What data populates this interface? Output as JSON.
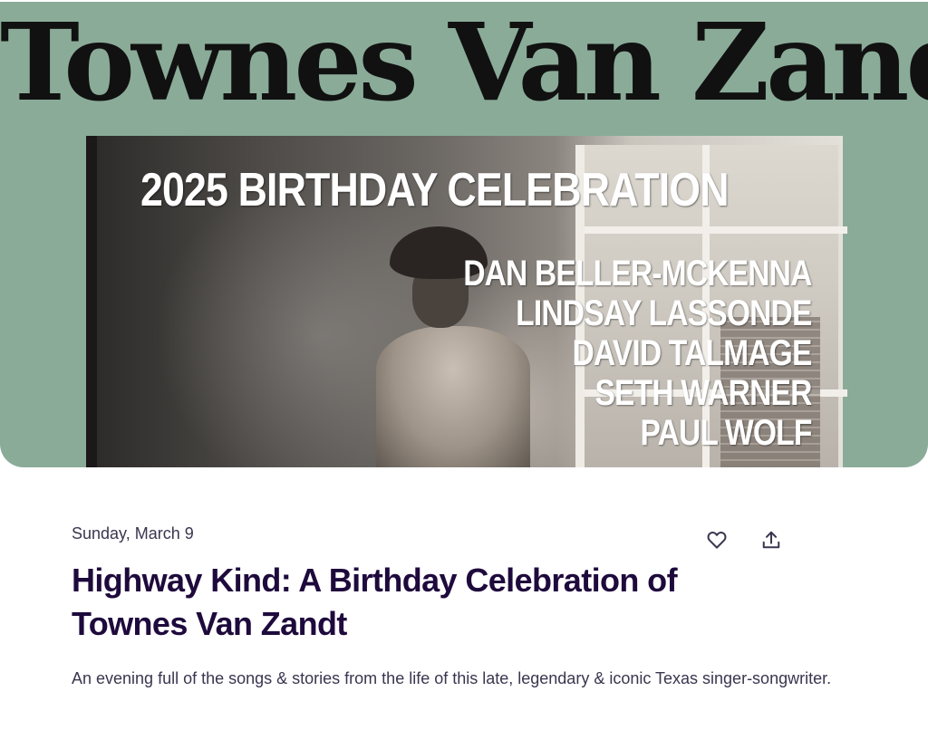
{
  "hero": {
    "title": "Townes Van Zandt",
    "heading": "2025  BIRTHDAY CELEBRATION",
    "performers": [
      "DAN BELLER-MCKENNA",
      "LINDSAY LASSONDE",
      "DAVID TALMAGE",
      "SETH WARNER",
      "PAUL WOLF"
    ],
    "background_color": "#8aab98"
  },
  "event": {
    "date": "Sunday, March 9",
    "title": "Highway Kind: A Birthday Celebration of Townes Van Zandt",
    "summary": "An evening full of the songs & stories from the life of this late, legendary & iconic Texas singer-songwriter.",
    "title_color": "#1e0a3c",
    "text_color": "#39364f"
  },
  "actions": {
    "like_icon": "heart-icon",
    "share_icon": "share-icon"
  }
}
